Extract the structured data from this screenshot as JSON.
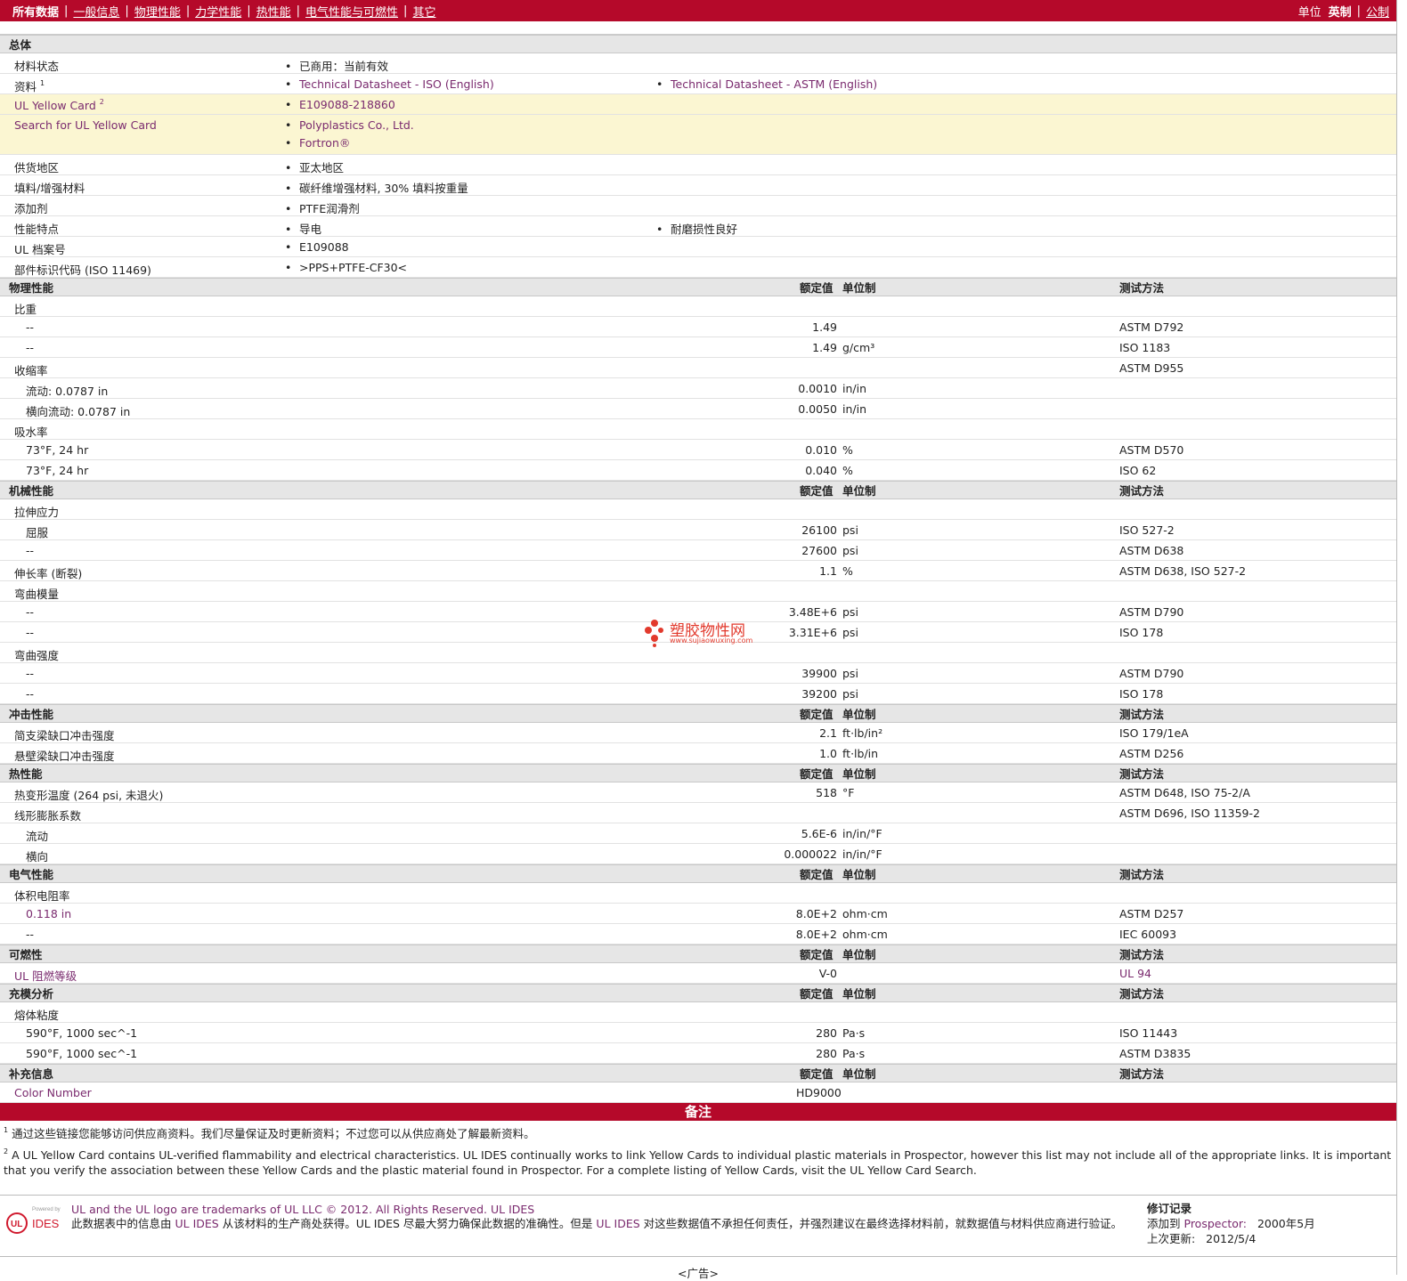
{
  "nav": {
    "items": [
      "所有数据",
      "一般信息",
      "物理性能",
      "力学性能",
      "热性能",
      "电气性能与可燃性",
      "其它"
    ],
    "unit_label": "单位",
    "unit_imperial": "英制",
    "unit_metric": "公制"
  },
  "general": {
    "title": "总体",
    "rows": {
      "status_label": "材料状态",
      "status_val": "已商用：当前有效",
      "docs_label": "资料",
      "docs_sup": "1",
      "docs_iso": "Technical Datasheet - ISO (English)",
      "docs_astm": "Technical Datasheet - ASTM (English)",
      "ulcard_label": "UL Yellow Card",
      "ulcard_sup": "2",
      "ulcard_val": "E109088-218860",
      "search_label": "Search for UL Yellow Card",
      "search_v1": "Polyplastics Co., Ltd.",
      "search_v2": "Fortron®",
      "region_label": "供货地区",
      "region_val": "亚太地区",
      "filler_label": "填料/增强材料",
      "filler_val": "碳纤维增强材料, 30% 填料按重量",
      "additive_label": "添加剂",
      "additive_val": "PTFE润滑剂",
      "feature_label": "性能特点",
      "feature_v1": "导电",
      "feature_v2": "耐磨损性良好",
      "ulfile_label": "UL 档案号",
      "ulfile_val": "E109088",
      "partcode_label": "部件标识代码 (ISO 11469)",
      "partcode_val": ">PPS+PTFE-CF30<"
    }
  },
  "headers": {
    "rated": "额定值",
    "unit": "单位制",
    "method": "测试方法"
  },
  "physical": {
    "title": "物理性能",
    "sg_label": "比重",
    "sg1": {
      "label": "--",
      "value": "1.49",
      "unit": "",
      "method": "ASTM D792"
    },
    "sg2": {
      "label": "--",
      "value": "1.49",
      "unit": "g/cm³",
      "method": "ISO 1183"
    },
    "shrink_label": "收缩率",
    "shrink_method": "ASTM D955",
    "shrink1": {
      "label": "流动: 0.0787 in",
      "value": "0.0010",
      "unit": "in/in"
    },
    "shrink2": {
      "label": "横向流动: 0.0787 in",
      "value": "0.0050",
      "unit": "in/in"
    },
    "water_label": "吸水率",
    "water1": {
      "label": "73°F, 24 hr",
      "value": "0.010",
      "unit": "%",
      "method": "ASTM D570"
    },
    "water2": {
      "label": "73°F, 24 hr",
      "value": "0.040",
      "unit": "%",
      "method": "ISO 62"
    }
  },
  "mechanical": {
    "title": "机械性能",
    "tensile_label": "拉伸应力",
    "t1": {
      "label": "屈服",
      "value": "26100",
      "unit": "psi",
      "method": "ISO 527-2"
    },
    "t2": {
      "label": "--",
      "value": "27600",
      "unit": "psi",
      "method": "ASTM D638"
    },
    "elong": {
      "label": "伸长率 (断裂)",
      "value": "1.1",
      "unit": "%",
      "method": "ASTM D638, ISO 527-2"
    },
    "fmod_label": "弯曲模量",
    "fm1": {
      "label": "--",
      "value": "3.48E+6",
      "unit": "psi",
      "method": "ASTM D790"
    },
    "fm2": {
      "label": "--",
      "value": "3.31E+6",
      "unit": "psi",
      "method": "ISO 178"
    },
    "fstr_label": "弯曲强度",
    "fs1": {
      "label": "--",
      "value": "39900",
      "unit": "psi",
      "method": "ASTM D790"
    },
    "fs2": {
      "label": "--",
      "value": "39200",
      "unit": "psi",
      "method": "ISO 178"
    }
  },
  "impact": {
    "title": "冲击性能",
    "charpy": {
      "label": "简支梁缺口冲击强度",
      "value": "2.1",
      "unit": "ft·lb/in²",
      "method": "ISO 179/1eA"
    },
    "izod": {
      "label": "悬壁梁缺口冲击强度",
      "value": "1.0",
      "unit": "ft·lb/in",
      "method": "ASTM D256"
    }
  },
  "thermal": {
    "title": "热性能",
    "hdt": {
      "label": "热变形温度 (264 psi, 未退火)",
      "value": "518",
      "unit": "°F",
      "method": "ASTM D648, ISO 75-2/A"
    },
    "clte_label": "线形膨胀系数",
    "clte_method": "ASTM D696, ISO 11359-2",
    "c1": {
      "label": "流动",
      "value": "5.6E-6",
      "unit": "in/in/°F"
    },
    "c2": {
      "label": "横向",
      "value": "0.000022",
      "unit": "in/in/°F"
    }
  },
  "electrical": {
    "title": "电气性能",
    "vr_label": "体积电阻率",
    "v1": {
      "label": "0.118 in",
      "value": "8.0E+2",
      "unit": "ohm·cm",
      "method": "ASTM D257"
    },
    "v2": {
      "label": "--",
      "value": "8.0E+2",
      "unit": "ohm·cm",
      "method": "IEC 60093"
    }
  },
  "flammability": {
    "title": "可燃性",
    "ul94": {
      "label": "UL 阻燃等级",
      "value": "V-0",
      "unit": "",
      "method": "UL 94"
    }
  },
  "filling": {
    "title": "充模分析",
    "mv_label": "熔体粘度",
    "m1": {
      "label": "590°F, 1000 sec^-1",
      "value": "280",
      "unit": "Pa·s",
      "method": "ISO 11443"
    },
    "m2": {
      "label": "590°F, 1000 sec^-1",
      "value": "280",
      "unit": "Pa·s",
      "method": "ASTM D3835"
    }
  },
  "supplement": {
    "title": "补充信息",
    "color": {
      "label": "Color Number",
      "value": "HD9000"
    }
  },
  "notes": {
    "title": "备注",
    "n1_sup": "1",
    "n1": "通过这些链接您能够访问供应商资料。我们尽量保证及时更新资料；不过您可以从供应商处了解最新资料。",
    "n2_sup": "2",
    "n2": "A UL Yellow Card contains UL-verified flammability and electrical characteristics. UL IDES continually works to link Yellow Cards to individual plastic materials in Prospector, however this list may not include all of the appropriate links. It is important that you verify the association between these Yellow Cards and the plastic material found in Prospector. For a complete listing of Yellow Cards, visit the UL Yellow Card Search."
  },
  "footer": {
    "logo_powered": "Powered by",
    "logo_ul": "UL",
    "logo_ides": "IDES",
    "line1": "UL and the UL logo are trademarks of UL LLC © 2012. All Rights Reserved. UL IDES",
    "line2a": "此数据表中的信息由",
    "line2b": "UL IDES",
    "line2c": "从该材料的生产商处获得。UL IDES 尽最大努力确保此数据的准确性。但是",
    "line2d": "UL IDES",
    "line2e": "对这些数据值不承担任何责任，并强烈建议在最终选择材料前，就数据值与材料供应商进行验证。",
    "rev_title": "修订记录",
    "rev_added_label": "添加到",
    "rev_added_src": "Prospector:",
    "rev_added_date": "2000年5月",
    "rev_updated_label": "上次更新:",
    "rev_updated_date": "2012/5/4",
    "ad": "<广告>"
  },
  "watermark": {
    "text": "塑胶物性网",
    "url": "www.sujiaowuxing.com"
  },
  "colors": {
    "brand": "#b5092a",
    "link": "#7a2a6e",
    "highlight": "#fbf6d2",
    "section": "#e6e6e6"
  }
}
